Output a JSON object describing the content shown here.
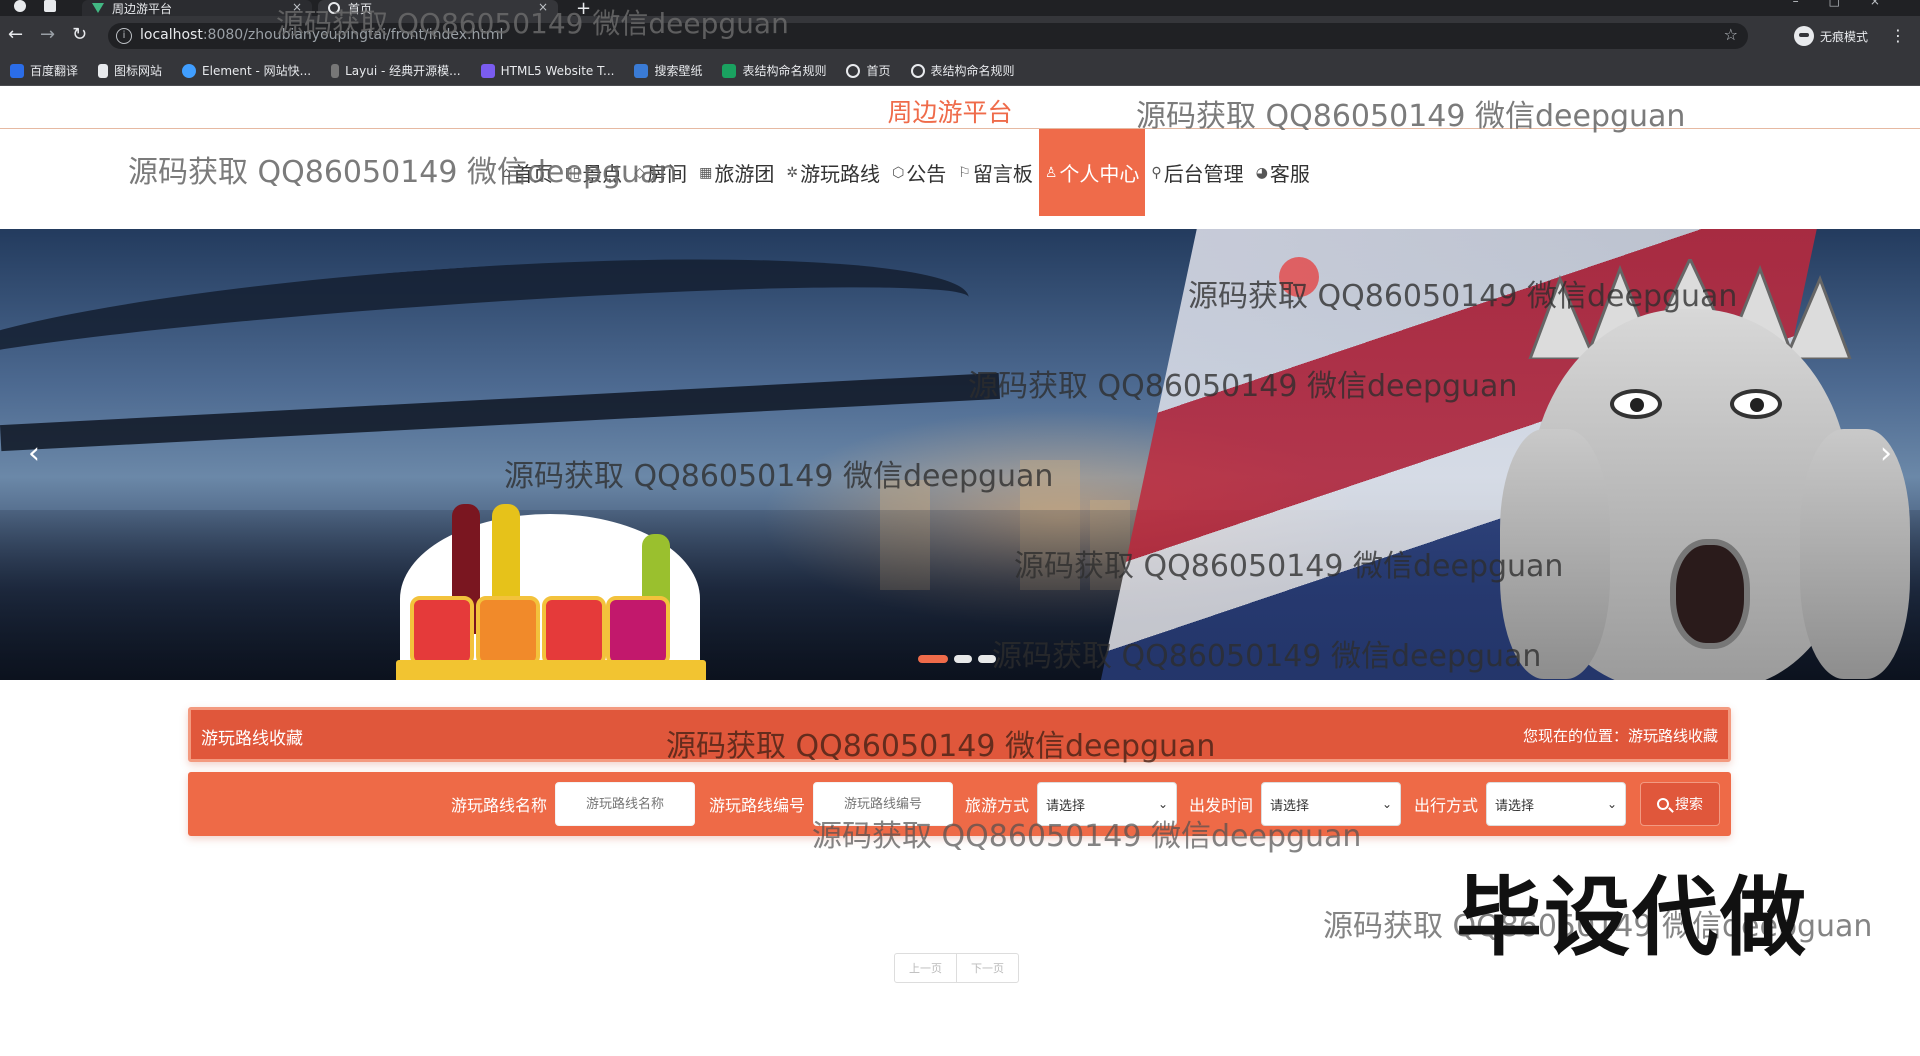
{
  "browser": {
    "tabs": [
      {
        "label": "周边游平台",
        "active": false
      },
      {
        "label": "首页",
        "active": true
      }
    ],
    "new_tab": "+",
    "url_host": "localhost",
    "url_path": ":8080/zhoubianyoupingtai/front/index.html",
    "profile_label": "无痕模式",
    "bookmarks": [
      {
        "label": "百度翻译",
        "color": "#2b6de8"
      },
      {
        "label": "图标网站",
        "color": "#e8eaed"
      },
      {
        "label": "Element - 网站快...",
        "color": "#409eff"
      },
      {
        "label": "Layui - 经典开源模...",
        "color": "#aaaaaa"
      },
      {
        "label": "HTML5 Website T...",
        "color": "#7a5cf0"
      },
      {
        "label": "搜索壁纸",
        "color": "#3a7bd5"
      },
      {
        "label": "表结构命名规则",
        "color": "#1aa260"
      },
      {
        "label": "首页",
        "color": "#e8eaed"
      },
      {
        "label": "表结构命名规则",
        "color": "#e8eaed"
      }
    ]
  },
  "site": {
    "title": "周边游平台",
    "nav": [
      {
        "icon": "⌂",
        "label": "首页",
        "active": false
      },
      {
        "icon": "▯▯",
        "label": "景点",
        "active": false
      },
      {
        "icon": "◇",
        "label": "房间",
        "active": false
      },
      {
        "icon": "▦",
        "label": "旅游团",
        "active": false
      },
      {
        "icon": "✲",
        "label": "游玩路线",
        "active": false
      },
      {
        "icon": "⬡",
        "label": "公告",
        "active": false
      },
      {
        "icon": "⚐",
        "label": "留言板",
        "active": false
      },
      {
        "icon": "♙",
        "label": "个人中心",
        "active": true
      },
      {
        "icon": "🔗︎",
        "label": "后台管理",
        "active": false
      },
      {
        "icon": "◕",
        "label": "客服",
        "active": false
      }
    ],
    "accent_color": "#ef6b4a"
  },
  "banner": {
    "prev_arrow": "‹",
    "next_arrow": "›",
    "slide_count": 3,
    "active_slide": 1
  },
  "section": {
    "title": "游玩路线收藏",
    "breadcrumb": "您现在的位置：游玩路线收藏"
  },
  "search": {
    "fields": [
      {
        "label": "游玩路线名称",
        "placeholder": "游玩路线名称",
        "type": "input"
      },
      {
        "label": "游玩路线编号",
        "placeholder": "游玩路线编号",
        "type": "input"
      },
      {
        "label": "旅游方式",
        "value": "请选择",
        "type": "select"
      },
      {
        "label": "出发时间",
        "value": "请选择",
        "type": "select"
      },
      {
        "label": "出行方式",
        "value": "请选择",
        "type": "select"
      }
    ],
    "button_label": "搜索"
  },
  "pager": {
    "prev": "上一页",
    "next": "下一页"
  },
  "watermark": {
    "text": "源码获取 QQ86050149 微信deepguan",
    "stamp": "毕设代做"
  }
}
